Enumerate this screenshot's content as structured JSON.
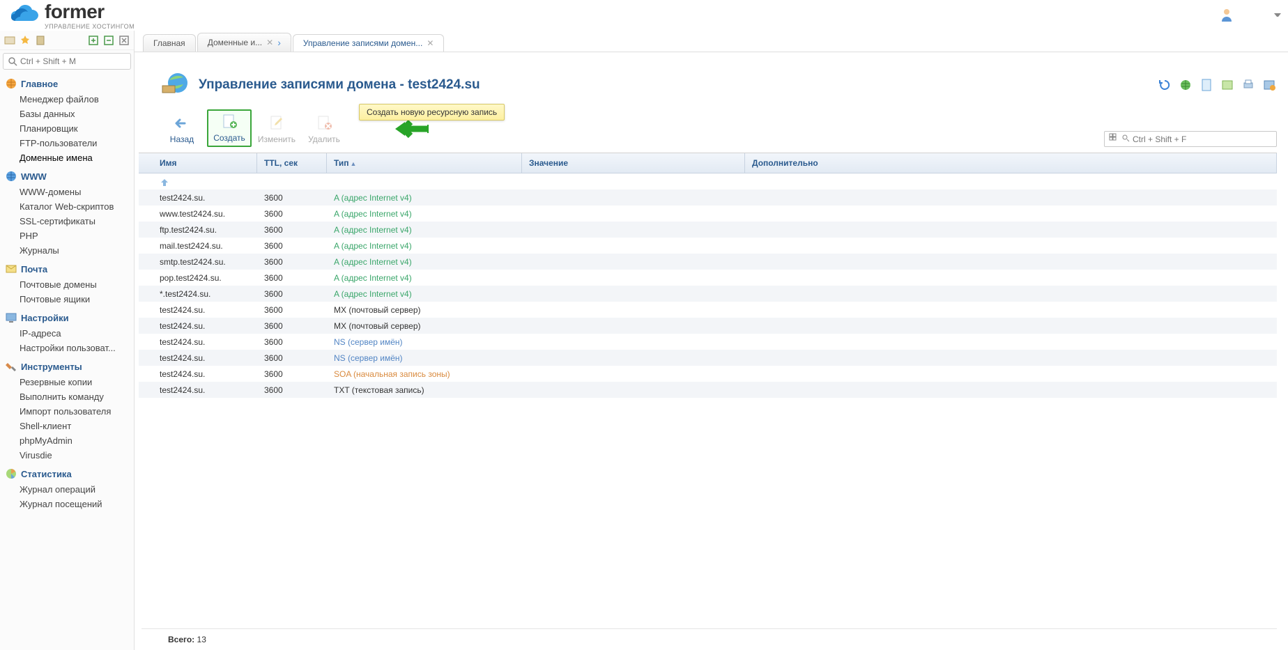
{
  "logo": {
    "name": "former",
    "tagline": "УПРАВЛЕНИЕ ХОСТИНГОМ"
  },
  "search": {
    "placeholder": "Ctrl + Shift + M"
  },
  "sidebar": {
    "sections": [
      {
        "title": "Главное",
        "icon": "globe-orange",
        "items": [
          "Менеджер файлов",
          "Базы данных",
          "Планировщик",
          "FTP-пользователи",
          "Доменные имена"
        ]
      },
      {
        "title": "WWW",
        "icon": "globe-blue",
        "items": [
          "WWW-домены",
          "Каталог Web-скриптов",
          "SSL-сертификаты",
          "PHP",
          "Журналы"
        ]
      },
      {
        "title": "Почта",
        "icon": "mail",
        "items": [
          "Почтовые домены",
          "Почтовые ящики"
        ]
      },
      {
        "title": "Настройки",
        "icon": "display",
        "items": [
          "IP-адреса",
          "Настройки пользоват..."
        ]
      },
      {
        "title": "Инструменты",
        "icon": "tools",
        "items": [
          "Резервные копии",
          "Выполнить команду",
          "Импорт пользователя",
          "Shell-клиент",
          "phpMyAdmin",
          "Virusdie"
        ]
      },
      {
        "title": "Статистика",
        "icon": "chart",
        "items": [
          "Журнал операций",
          "Журнал посещений"
        ]
      }
    ]
  },
  "tabs": [
    {
      "label": "Главная",
      "closable": false
    },
    {
      "label": "Доменные и...",
      "closable": true,
      "chevron": true
    },
    {
      "label": "Управление записями домен...",
      "closable": true,
      "active": true
    }
  ],
  "page_title": "Управление записями домена - test2424.su",
  "tooltip": "Создать новую ресурсную запись",
  "actions": {
    "back": "Назад",
    "create": "Создать",
    "edit": "Изменить",
    "delete": "Удалить"
  },
  "filter": {
    "placeholder": "Ctrl + Shift + F"
  },
  "columns": {
    "name": "Имя",
    "ttl": "TTL, сек",
    "type": "Тип",
    "value": "Значение",
    "extra": "Дополнительно"
  },
  "rows": [
    {
      "name": "test2424.su.",
      "ttl": "3600",
      "type": "A (адрес Internet v4)",
      "tclass": "type-a"
    },
    {
      "name": "www.test2424.su.",
      "ttl": "3600",
      "type": "A (адрес Internet v4)",
      "tclass": "type-a"
    },
    {
      "name": "ftp.test2424.su.",
      "ttl": "3600",
      "type": "A (адрес Internet v4)",
      "tclass": "type-a"
    },
    {
      "name": "mail.test2424.su.",
      "ttl": "3600",
      "type": "A (адрес Internet v4)",
      "tclass": "type-a"
    },
    {
      "name": "smtp.test2424.su.",
      "ttl": "3600",
      "type": "A (адрес Internet v4)",
      "tclass": "type-a"
    },
    {
      "name": "pop.test2424.su.",
      "ttl": "3600",
      "type": "A (адрес Internet v4)",
      "tclass": "type-a"
    },
    {
      "name": "*.test2424.su.",
      "ttl": "3600",
      "type": "A (адрес Internet v4)",
      "tclass": "type-a"
    },
    {
      "name": "test2424.su.",
      "ttl": "3600",
      "type": "MX (почтовый сервер)",
      "tclass": ""
    },
    {
      "name": "test2424.su.",
      "ttl": "3600",
      "type": "MX (почтовый сервер)",
      "tclass": ""
    },
    {
      "name": "test2424.su.",
      "ttl": "3600",
      "type": "NS (сервер имён)",
      "tclass": "type-ns"
    },
    {
      "name": "test2424.su.",
      "ttl": "3600",
      "type": "NS (сервер имён)",
      "tclass": "type-ns"
    },
    {
      "name": "test2424.su.",
      "ttl": "3600",
      "type": "SOA (начальная запись зоны)",
      "tclass": "type-soa"
    },
    {
      "name": "test2424.su.",
      "ttl": "3600",
      "type": "TXT (текстовая запись)",
      "tclass": ""
    }
  ],
  "footer": {
    "label": "Всего:",
    "count": "13"
  }
}
